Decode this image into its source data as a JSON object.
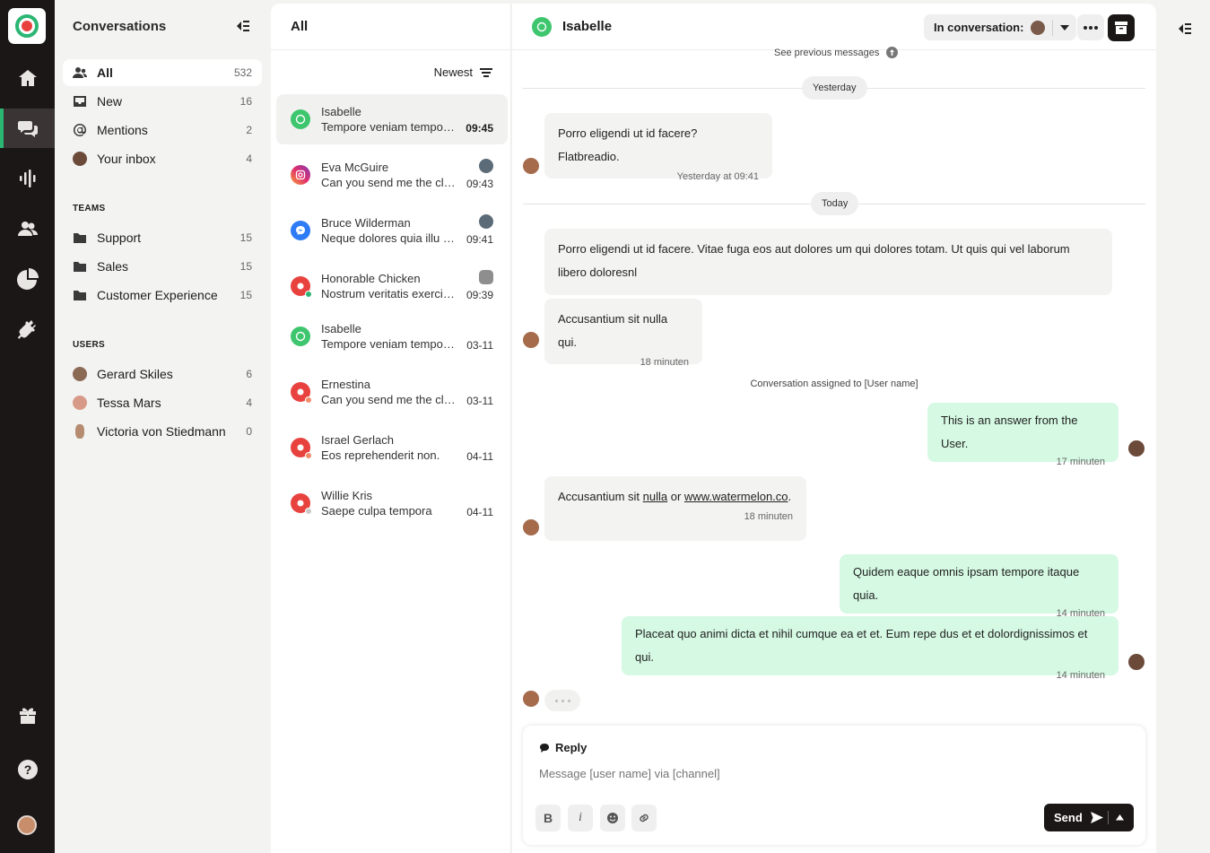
{
  "rail": {
    "items": [
      "home-icon",
      "chat-icon",
      "analytics-icon",
      "contacts-icon",
      "reports-icon",
      "integrations-icon"
    ],
    "bottom": [
      "gift-icon",
      "help-icon"
    ]
  },
  "side": {
    "title": "Conversations",
    "inbox": [
      {
        "label": "All",
        "count": "532"
      },
      {
        "label": "New",
        "count": "16"
      },
      {
        "label": "Mentions",
        "count": "2"
      },
      {
        "label": "Your inbox",
        "count": "4"
      }
    ],
    "teams_title": "TEAMS",
    "teams": [
      {
        "label": "Support",
        "count": "15"
      },
      {
        "label": "Sales",
        "count": "15"
      },
      {
        "label": "Customer Experience",
        "count": "15"
      }
    ],
    "users_title": "USERS",
    "users": [
      {
        "label": "Gerard Skiles",
        "count": "6"
      },
      {
        "label": "Tessa Mars",
        "count": "4"
      },
      {
        "label": "Victoria von Stiedmann",
        "count": "0"
      }
    ]
  },
  "list": {
    "title": "All",
    "sort": "Newest",
    "items": [
      {
        "name": "Isabelle",
        "preview": "Tempore veniam tempore ipsum",
        "time": "09:45",
        "channel": "whatsapp"
      },
      {
        "name": "Eva McGuire",
        "preview": "Can you send me the client list",
        "time": "09:43",
        "channel": "instagram"
      },
      {
        "name": "Bruce Wilderman",
        "preview": "Neque dolores quia illu parum",
        "time": "09:41",
        "channel": "messenger"
      },
      {
        "name": "Honorable Chicken",
        "preview": "Nostrum veritatis exercitationem",
        "time": "09:39",
        "channel": "webchat"
      },
      {
        "name": "Isabelle",
        "preview": "Tempore veniam tempore ipsum",
        "time": "03-11",
        "channel": "whatsapp"
      },
      {
        "name": "Ernestina",
        "preview": "Can you send me the client list",
        "time": "03-11",
        "channel": "webchat"
      },
      {
        "name": "Israel Gerlach",
        "preview": "Eos reprehenderit non.",
        "time": "04-11",
        "channel": "webchat"
      },
      {
        "name": "Willie Kris",
        "preview": "Saepe culpa tempora",
        "time": "04-11",
        "channel": "webchat"
      }
    ]
  },
  "chat": {
    "contact": "Isabelle",
    "state_label": "In conversation:",
    "see_previous": "See previous messages",
    "day_yesterday": "Yesterday",
    "day_today": "Today",
    "messages": [
      {
        "text": "Porro eligendi ut id facere? Flatbreadio.",
        "meta": "Yesterday at 09:41"
      },
      {
        "text": "Porro eligendi ut id facere. Vitae fuga eos aut dolores um qui dolores totam. Ut quis qui vel laborum libero doloresnl",
        "meta": ""
      },
      {
        "text": "Accusantium sit nulla qui.",
        "meta": "18 minuten"
      },
      {
        "text": "This is an answer from the User.",
        "meta": "17 minuten"
      },
      {
        "text_a": "Accusantium sit ",
        "text_link1": "nulla",
        "text_b": " or ",
        "text_link2": "www.watermelon.co",
        "text_c": ".",
        "meta": "18 minuten"
      },
      {
        "text": "Quidem eaque omnis ipsam tempore itaque quia.",
        "meta": "14 minuten"
      },
      {
        "text": "Placeat quo animi dicta et nihil cumque ea et et. Eum repe dus et et dolordignissimos et qui.",
        "meta": "14 minuten"
      }
    ],
    "system": "Conversation assigned to [User name]",
    "reply_label": "Reply",
    "reply_placeholder": "Message [user name] via [channel]",
    "send": "Send"
  }
}
